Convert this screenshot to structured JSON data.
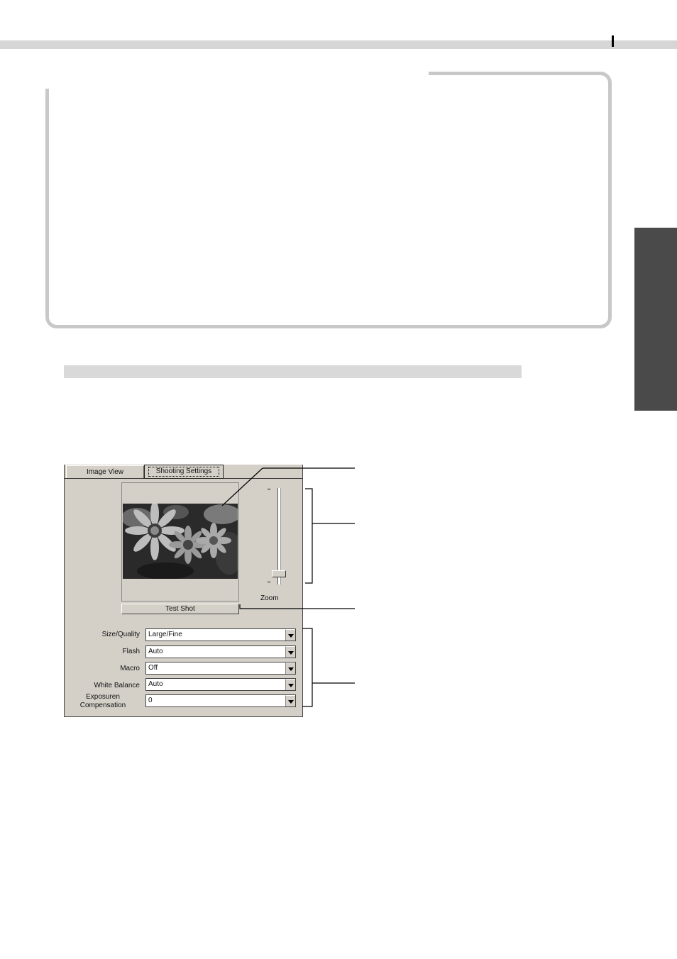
{
  "dialog": {
    "tabs": [
      {
        "label": "Image View",
        "active": false
      },
      {
        "label": "Shooting Settings",
        "active": true
      }
    ],
    "zoom_label": "Zoom",
    "zoom_level": 0.88,
    "test_shot_label": "Test Shot",
    "settings": [
      {
        "label": "Size/Quality",
        "value": "Large/Fine"
      },
      {
        "label": "Flash",
        "value": "Auto"
      },
      {
        "label": "Macro",
        "value": "Off"
      },
      {
        "label": "White Balance",
        "value": "Auto"
      },
      {
        "label": "Exposuren Compensation",
        "value": "0"
      }
    ]
  },
  "colors": {
    "dialog_bg": "#d4d0c8",
    "side_tab": "#4a4a4a",
    "top_bar": "#d6d6d6"
  }
}
